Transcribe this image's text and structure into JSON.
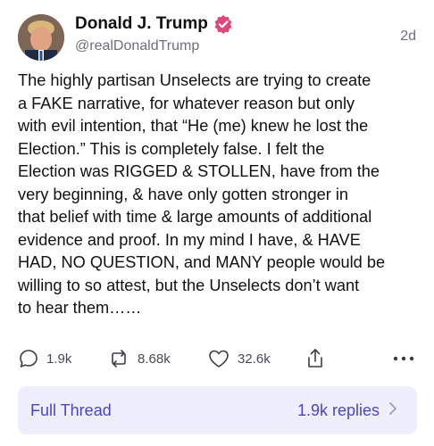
{
  "post": {
    "author_name": "Donald J. Trump",
    "handle": "@realDonaldTrump",
    "timestamp": "2d",
    "text": "The highly partisan Unselects are trying to create\na FAKE narrative, for whatever reason but only\nwith evil intention, that “He (me) knew he lost the\nElection.” This is completely false. I felt the\nElection was RIGGED & STOLLEN, have from the\nvery beginning, & have only gotten stronger in\nthat belief with time & large amounts of additional\nevidence and proof. In my mind I have, & HAVE\nHAD, NO QUESTION, and MANY people would be\nwilling to so attest, but the Unselects don’t want\nto hear them……"
  },
  "actions": {
    "reply_count": "1.9k",
    "repost_count": "8.68k",
    "like_count": "32.6k"
  },
  "thread_bar": {
    "label": "Full Thread",
    "replies": "1.9k replies"
  },
  "colors": {
    "verified_badge": "#e0457b",
    "thread_bar_bg": "#efeefc",
    "thread_text": "#4b46c9"
  },
  "icons": [
    "verified-icon",
    "reply-icon",
    "repost-icon",
    "like-icon",
    "share-icon",
    "more-icon",
    "chevron-right-icon"
  ]
}
